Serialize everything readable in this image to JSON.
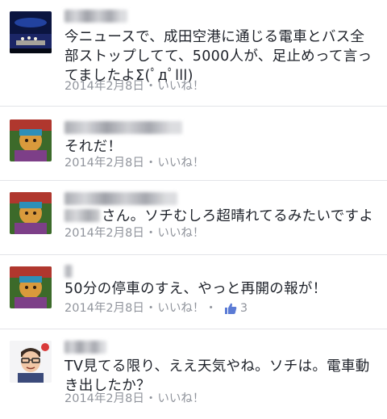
{
  "comments": [
    {
      "avatar": "concert-stage-photo",
      "text": "今ニュースで、成田空港に通じる電車とバス全部ストップしてて、5000人が、足止めって言ってましたよΣ(ﾟдﾟlll)",
      "date": "2014年2月8日",
      "separator": "・",
      "like_label": "いいね！"
    },
    {
      "avatar": "colorful-character-photo",
      "text": "それだ！",
      "date": "2014年2月8日",
      "separator": "・",
      "like_label": "いいね！"
    },
    {
      "avatar": "colorful-character-photo",
      "text": "さん。ソチむしろ超晴れてるみたいですよ",
      "date": "2014年2月8日",
      "separator": "・",
      "like_label": "いいね！"
    },
    {
      "avatar": "colorful-character-photo",
      "text": "50分の停車のすえ、やっと再開の報が！",
      "date": "2014年2月8日",
      "separator": "・",
      "like_label": "いいね！",
      "like_count": "3",
      "like_icon": "thumbs-up-icon",
      "like_color": "#5b7bd5"
    },
    {
      "avatar": "cartoon-man-photo",
      "text": "TV見てる限り、ええ天気やね。ソチは。電車動き出したか？",
      "date": "2014年2月8日",
      "separator": "・",
      "like_label": "いいね！"
    }
  ]
}
